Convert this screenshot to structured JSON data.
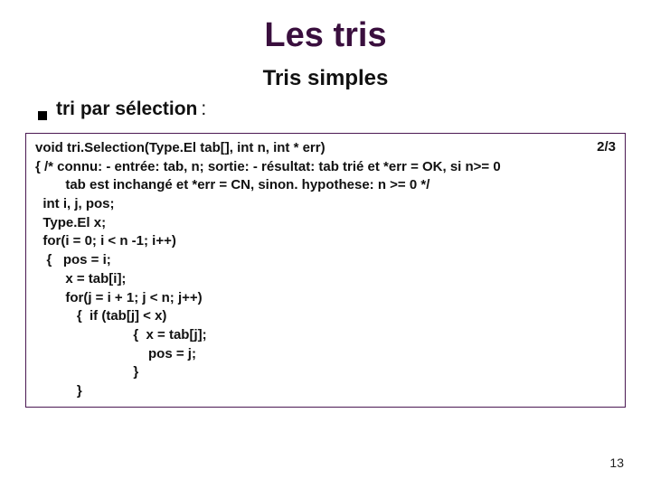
{
  "title": "Les tris",
  "subtitle": "Tris simples",
  "bullet": "tri par sélection",
  "colon": ":",
  "pager": "2/3",
  "code": {
    "l1": "void tri.Selection(Type.El tab[], int n, int * err)",
    "l2": "{ /* connu: - entrée: tab, n; sortie: - résultat: tab trié et *err = OK, si n>= 0",
    "l3": "        tab est inchangé et *err = CN, sinon. hypothese: n >= 0 */",
    "l4": "  int i, j, pos;",
    "l5": "  Type.El x;",
    "l6": "  for(i = 0; i < n -1; i++)",
    "l7": "   {   pos = i;",
    "l8": "        x = tab[i];",
    "l9": "        for(j = i + 1; j < n; j++)",
    "l10": "           {  if (tab[j] < x)",
    "l11": "                          {  x = tab[j];",
    "l12": "                              pos = j;",
    "l13": "                          }",
    "l14": "           }"
  },
  "slide_number": "13"
}
